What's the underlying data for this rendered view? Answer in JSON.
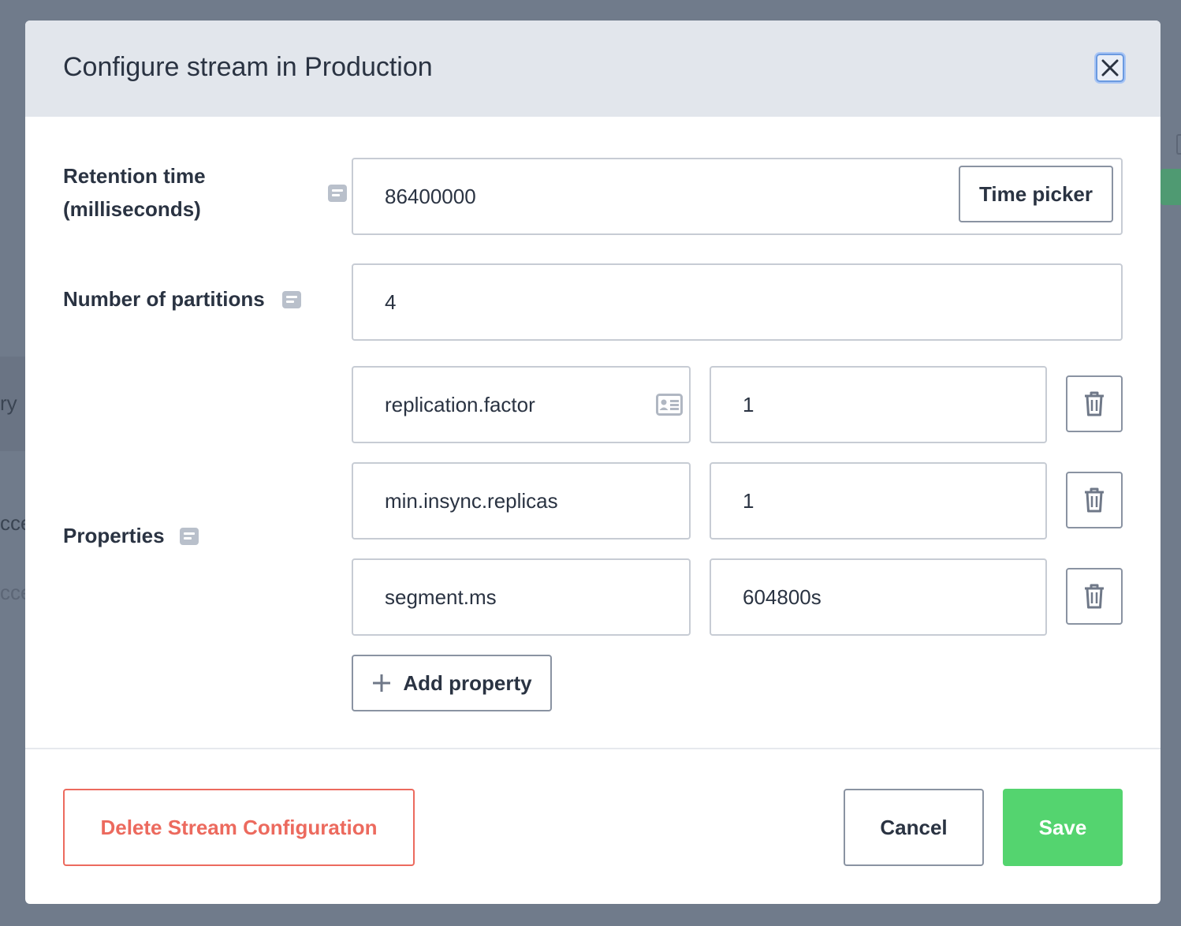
{
  "dialog": {
    "title": "Configure stream in Production"
  },
  "retention": {
    "label_line1": "Retention time",
    "label_line2": "(milliseconds)",
    "value": "86400000",
    "time_picker_label": "Time picker"
  },
  "partitions": {
    "label": "Number of partitions",
    "value": "4"
  },
  "properties": {
    "label": "Properties",
    "items": [
      {
        "key": "replication.factor",
        "value": "1"
      },
      {
        "key": "min.insync.replicas",
        "value": "1"
      },
      {
        "key": "segment.ms",
        "value": "604800s"
      }
    ],
    "add_label": "Add property"
  },
  "footer": {
    "delete_label": "Delete Stream Configuration",
    "cancel_label": "Cancel",
    "save_label": "Save"
  },
  "colors": {
    "save": "#54d46f",
    "delete": "#ec6a5e",
    "header_bg": "#e2e6ec",
    "overlay": "#707b8b"
  }
}
